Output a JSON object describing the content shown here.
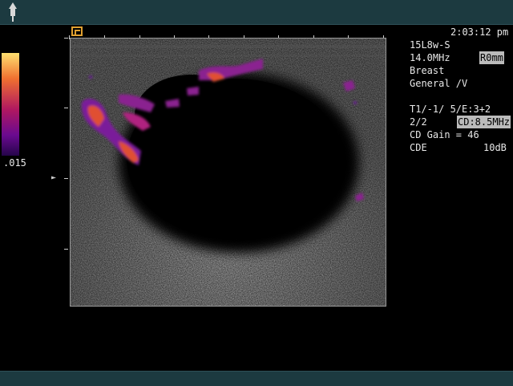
{
  "header": {
    "time": "2:03:12 pm"
  },
  "colorbar": {
    "scale_label": ".015",
    "colors": [
      "#ffe070",
      "#f07030",
      "#b01860",
      "#6a0a90",
      "#25054a"
    ]
  },
  "settings": {
    "probe": "15L8w-S",
    "frequency": "14.0MHz",
    "region": "R0mm",
    "preset": "Breast",
    "exam": "General /V",
    "params_line1": "T1/-1/ 5/E:3+2",
    "params_line2_left": "2/2",
    "cd_freq": "CD:8.5MHz",
    "cd_gain": "CD Gain = 46",
    "mode": "CDE",
    "db": "10dB"
  },
  "icons": {
    "probe": "probe-icon",
    "roi": "roi-box-icon",
    "focus": "focus-marker-icon"
  }
}
